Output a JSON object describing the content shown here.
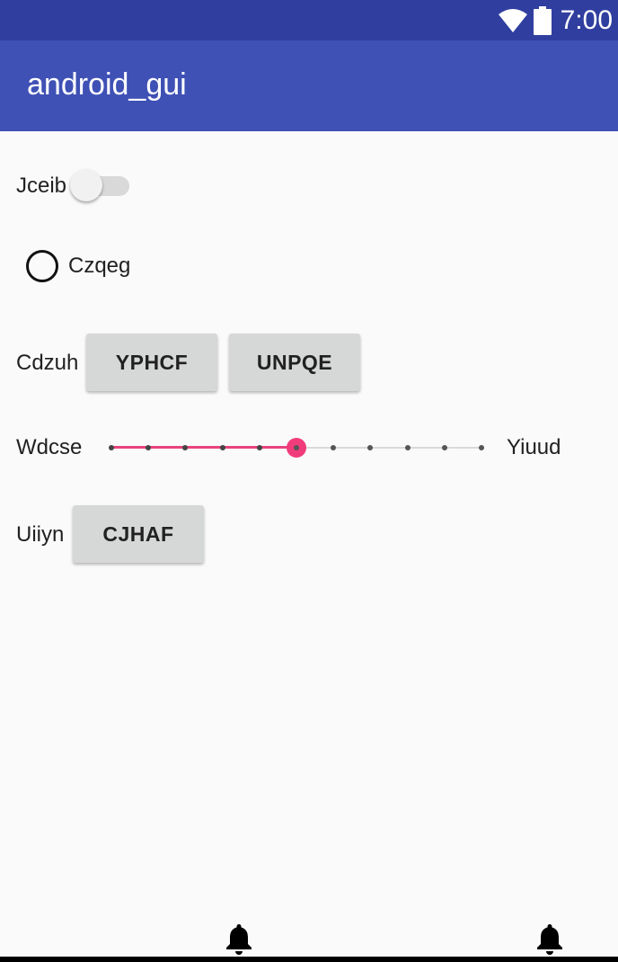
{
  "status_bar": {
    "time": "7:00",
    "icons": [
      "wifi-icon",
      "battery-icon"
    ]
  },
  "app_bar": {
    "title": "android_gui"
  },
  "switch_row": {
    "label": "Jceib",
    "checked": false
  },
  "radio_row": {
    "label": "Czqeg",
    "checked": false
  },
  "button_row_1": {
    "label": "Cdzuh",
    "buttons": [
      "YPHCF",
      "UNPQE"
    ]
  },
  "slider_row": {
    "label_left": "Wdcse",
    "label_right": "Yiuud",
    "steps": 10,
    "value": 5
  },
  "button_row_2": {
    "label": "Uiiyn",
    "button": "CJHAF"
  },
  "bottom_bar": {
    "icons": [
      "bell-icon",
      "bell-icon"
    ]
  },
  "colors": {
    "status_bar": "#303f9f",
    "app_bar": "#3f51b5",
    "accent": "#f03c7b",
    "background": "#fafafa"
  }
}
